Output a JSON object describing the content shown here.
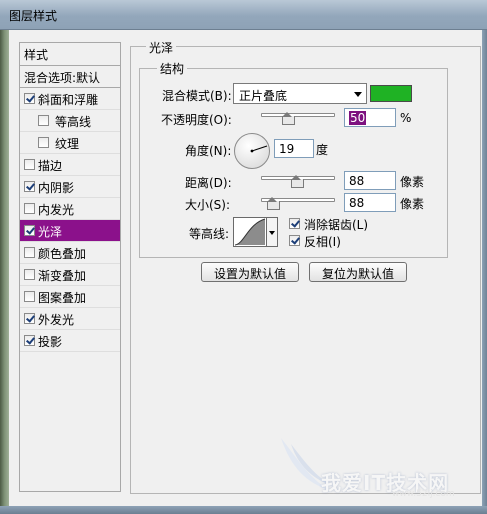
{
  "window": {
    "title": "图层样式"
  },
  "styles_panel": {
    "header": "样式",
    "blend_options": "混合选项:默认",
    "items": [
      {
        "label": "斜面和浮雕",
        "checked": true
      },
      {
        "label": "等高线",
        "checked": false
      },
      {
        "label": "纹理",
        "checked": false
      },
      {
        "label": "描边",
        "checked": false
      },
      {
        "label": "内阴影",
        "checked": true
      },
      {
        "label": "内发光",
        "checked": false
      },
      {
        "label": "光泽",
        "checked": true
      },
      {
        "label": "颜色叠加",
        "checked": false
      },
      {
        "label": "渐变叠加",
        "checked": false
      },
      {
        "label": "图案叠加",
        "checked": false
      },
      {
        "label": "外发光",
        "checked": true
      },
      {
        "label": "投影",
        "checked": true
      }
    ],
    "selected": "光泽"
  },
  "satin": {
    "title": "光泽",
    "structure_title": "结构",
    "blend_mode": {
      "label": "混合模式(B):",
      "value": "正片叠底"
    },
    "color": "#1fb224",
    "opacity": {
      "label": "不透明度(O):",
      "value": "50",
      "unit": "%"
    },
    "angle": {
      "label": "角度(N):",
      "value": "19",
      "unit": "度"
    },
    "distance": {
      "label": "距离(D):",
      "value": "88",
      "unit": "像素"
    },
    "size": {
      "label": "大小(S):",
      "value": "88",
      "unit": "像素"
    },
    "contour": {
      "label": "等高线:"
    },
    "anti_alias": {
      "label": "消除锯齿(L)",
      "checked": true
    },
    "invert": {
      "label": "反相(I)",
      "checked": true
    },
    "make_default": "设置为默认值",
    "reset_default": "复位为默认值"
  },
  "watermark": {
    "text": "我爱IT技术网",
    "url": "www.52ij.com"
  }
}
